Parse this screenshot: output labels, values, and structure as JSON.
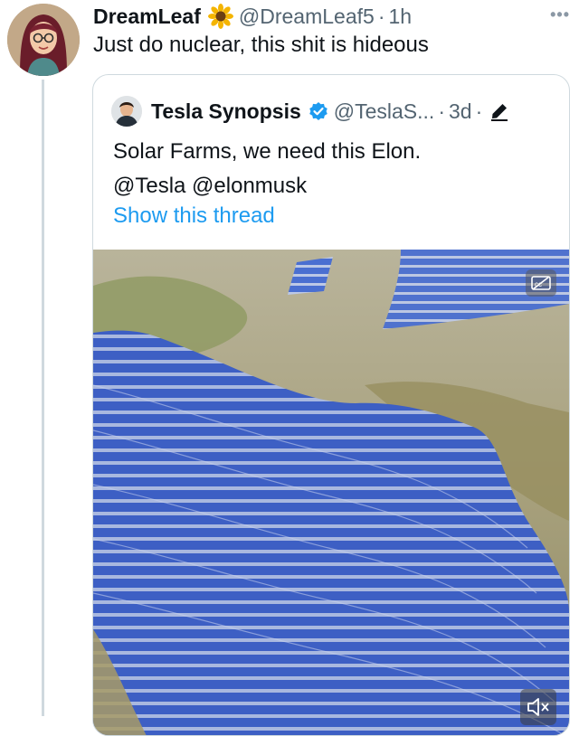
{
  "tweet": {
    "author_name": "DreamLeaf",
    "author_emoji_icon": "sunflower-icon",
    "handle": "@DreamLeaf5",
    "separator": "·",
    "time": "1h",
    "more_icon": "more-dots-icon",
    "more_glyph": "•••",
    "text": "Just do nuclear, this shit is hideous"
  },
  "quote": {
    "author_name": "Tesla Synopsis",
    "verified_icon": "verified-badge-icon",
    "handle": "@TeslaS...",
    "separator": "·",
    "time": "3d",
    "separator2": "·",
    "edited_icon": "pencil-icon",
    "lines": [
      "Solar Farms, we need this Elon.",
      "@Tesla @elonmusk"
    ],
    "show_thread_label": "Show this thread",
    "media_type": "video",
    "cc_icon": "closed-captions-off-icon",
    "mute_icon": "muted-speaker-icon"
  },
  "colors": {
    "text_primary": "#0f1419",
    "text_secondary": "#536471",
    "link": "#1d9bf0",
    "verified": "#1d9bf0",
    "border": "#cfd9de"
  }
}
